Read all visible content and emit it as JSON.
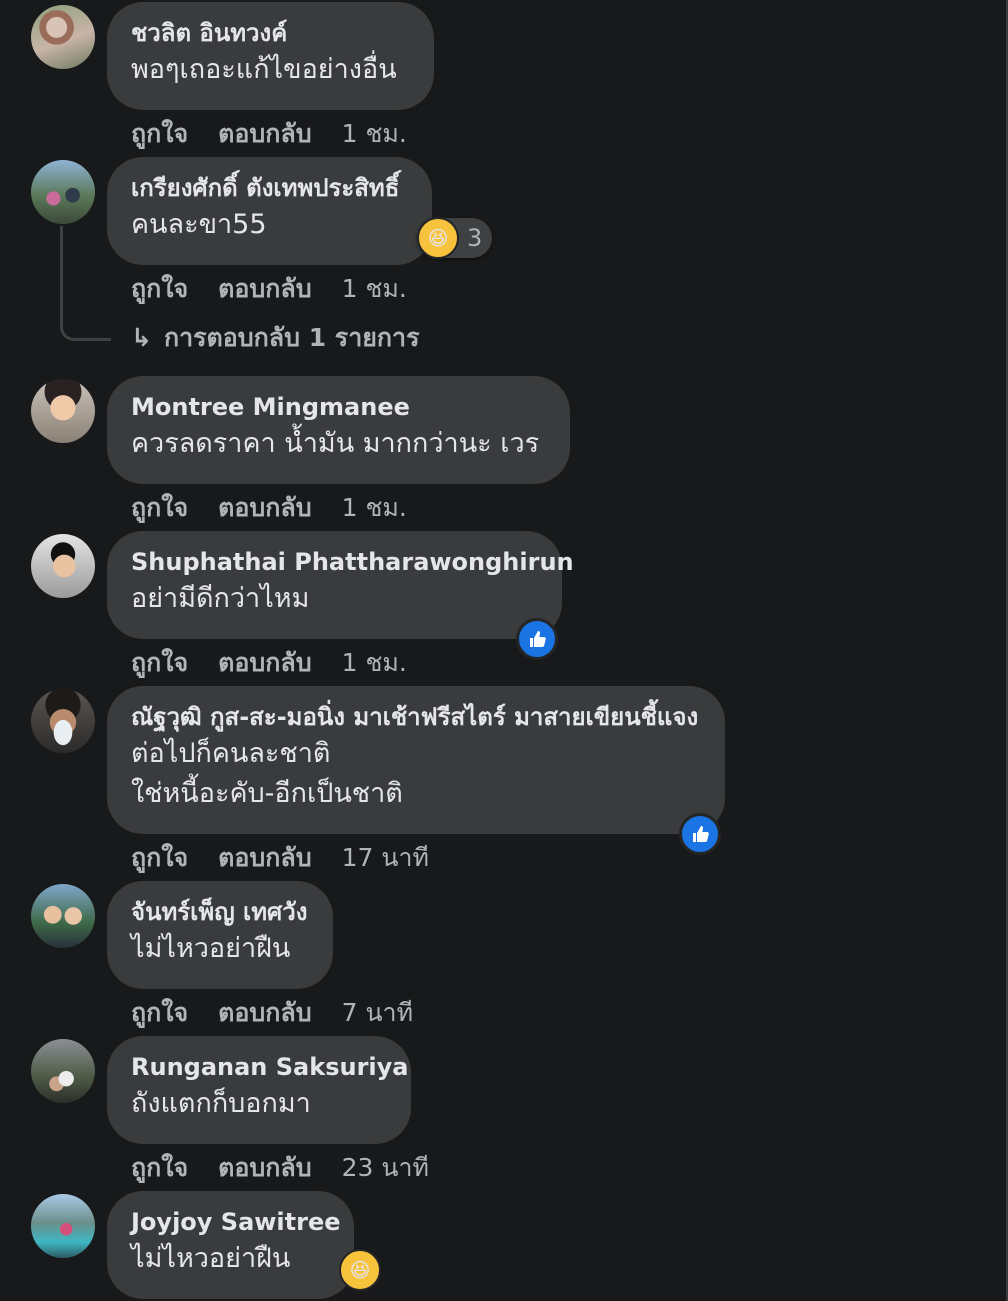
{
  "actions": {
    "like": "ถูกใจ",
    "reply": "ตอบกลับ"
  },
  "comments": [
    {
      "author": "ชวลิต อินทวงค์",
      "lines": [
        "พอๆเถอะแก้ไขอย่างอื่น"
      ],
      "time": "1 ชม."
    },
    {
      "author": "เกรียงศักดิ์ ตังเทพประสิทธิ์",
      "lines": [
        "คนละขา55"
      ],
      "time": "1 ชม.",
      "reaction": {
        "icon": "haha-icon",
        "count": "3"
      },
      "replies_label": "การตอบกลับ 1 รายการ"
    },
    {
      "author": "Montree Mingmanee",
      "lines": [
        "ควรลดราคา น้ำมัน มากกว่านะ เวร"
      ],
      "time": "1 ชม."
    },
    {
      "author": "Shuphathai Phattharawonghirun",
      "lines": [
        "อย่ามีดีกว่าไหม"
      ],
      "time": "1 ชม.",
      "reaction": {
        "icon": "like-icon"
      }
    },
    {
      "author": "ณัฐวุฒิ กูส-สะ-มอนิ่ง มาเช้าฟรีสไตร์ มาสายเขียนชี้แจง",
      "lines": [
        "ต่อไปก็คนละชาติ",
        "ใช่หนี้อะคับ-อีกเป็นชาติ"
      ],
      "time": "17 นาที",
      "reaction": {
        "icon": "like-icon"
      }
    },
    {
      "author": "จันทร์เพ็ญ เทศวัง",
      "lines": [
        "ไม่ไหวอย่าฝืน"
      ],
      "time": "7 นาที"
    },
    {
      "author": "Runganan Saksuriya",
      "lines": [
        "ถังแตกก็บอกมา"
      ],
      "time": "23 นาที"
    },
    {
      "author": "Joyjoy Sawitree",
      "lines": [
        "ไม่ไหวอย่าฝืน"
      ],
      "reaction": {
        "icon": "haha-icon"
      }
    }
  ],
  "colors": {
    "background": "#18191a",
    "bubble": "#3a3b3c",
    "secondary_text": "#b0b3b8",
    "like_blue": "#1b74e4",
    "haha_yellow": "#f7c33d"
  }
}
